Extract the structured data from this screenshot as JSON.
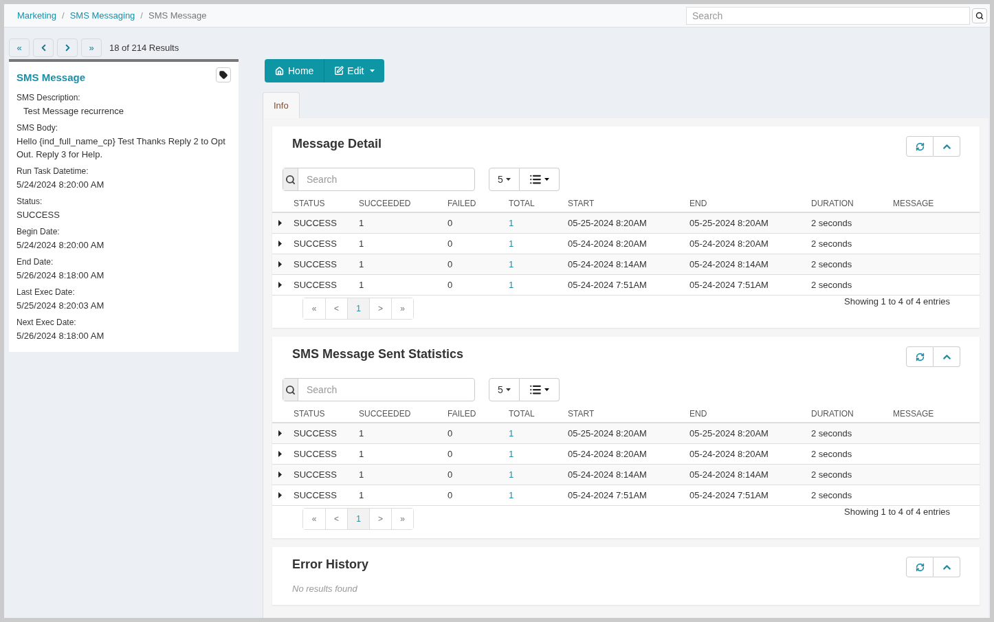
{
  "breadcrumb_separator": "/",
  "breadcrumb": [
    {
      "label": "Marketing",
      "current": false
    },
    {
      "label": "SMS Messaging",
      "current": false
    },
    {
      "label": "SMS Message",
      "current": true
    }
  ],
  "search": {
    "placeholder": "Search"
  },
  "record_nav": {
    "buttons": [
      {
        "kind": "first",
        "label": "«"
      },
      {
        "kind": "prev"
      },
      {
        "kind": "next"
      },
      {
        "kind": "last",
        "label": "»"
      }
    ],
    "results": "18 of 214 Results"
  },
  "sidebar": {
    "title": "SMS Message",
    "fields": [
      {
        "label": "SMS Description:",
        "value": "Test Message recurrence",
        "indented": true
      },
      {
        "label": "SMS Body:",
        "value": "Hello {ind_full_name_cp} Test Thanks Reply 2 to Opt Out. Reply 3 for Help.",
        "indented": false
      },
      {
        "label": "Run Task Datetime:",
        "value": "5/24/2024 8:20:00 AM",
        "indented": false
      },
      {
        "label": "Status:",
        "value": "SUCCESS",
        "indented": false
      },
      {
        "label": "Begin Date:",
        "value": "5/24/2024 8:20:00 AM",
        "indented": false
      },
      {
        "label": "End Date:",
        "value": "5/26/2024 8:18:00 AM",
        "indented": false
      },
      {
        "label": "Last Exec Date:",
        "value": "5/25/2024 8:20:03 AM",
        "indented": false
      },
      {
        "label": "Next Exec Date:",
        "value": "5/26/2024 8:18:00 AM",
        "indented": false
      }
    ]
  },
  "toolbar": {
    "home": "Home",
    "edit": "Edit"
  },
  "tabs": [
    {
      "label": "Info",
      "selected": true
    }
  ],
  "panels": [
    {
      "kind": "table",
      "title": "Message Detail",
      "search_placeholder": "Search",
      "page_size": "5",
      "columns": [
        "STATUS",
        "SUCCEEDED",
        "FAILED",
        "TOTAL",
        "START",
        "END",
        "DURATION",
        "MESSAGE"
      ],
      "rows": [
        {
          "status": "SUCCESS",
          "succeeded": "1",
          "failed": "0",
          "total": "1",
          "start": "05-25-2024 8:20AM",
          "end": "05-25-2024 8:20AM",
          "duration": "2 seconds"
        },
        {
          "status": "SUCCESS",
          "succeeded": "1",
          "failed": "0",
          "total": "1",
          "start": "05-24-2024 8:20AM",
          "end": "05-24-2024 8:20AM",
          "duration": "2 seconds"
        },
        {
          "status": "SUCCESS",
          "succeeded": "1",
          "failed": "0",
          "total": "1",
          "start": "05-24-2024 8:14AM",
          "end": "05-24-2024 8:14AM",
          "duration": "2 seconds"
        },
        {
          "status": "SUCCESS",
          "succeeded": "1",
          "failed": "0",
          "total": "1",
          "start": "05-24-2024 7:51AM",
          "end": "05-24-2024 7:51AM",
          "duration": "2 seconds"
        }
      ],
      "pagination": [
        {
          "label": "«",
          "selected": false
        },
        {
          "label": "<",
          "selected": false
        },
        {
          "label": "1",
          "selected": true
        },
        {
          "label": ">",
          "selected": false
        },
        {
          "label": "»",
          "selected": false
        }
      ],
      "info": "Showing 1 to 4 of 4 entries"
    },
    {
      "kind": "table",
      "title": "SMS Message Sent Statistics",
      "search_placeholder": "Search",
      "page_size": "5",
      "columns": [
        "STATUS",
        "SUCCEEDED",
        "FAILED",
        "TOTAL",
        "START",
        "END",
        "DURATION",
        "MESSAGE"
      ],
      "rows": [
        {
          "status": "SUCCESS",
          "succeeded": "1",
          "failed": "0",
          "total": "1",
          "start": "05-25-2024 8:20AM",
          "end": "05-25-2024 8:20AM",
          "duration": "2 seconds"
        },
        {
          "status": "SUCCESS",
          "succeeded": "1",
          "failed": "0",
          "total": "1",
          "start": "05-24-2024 8:20AM",
          "end": "05-24-2024 8:20AM",
          "duration": "2 seconds"
        },
        {
          "status": "SUCCESS",
          "succeeded": "1",
          "failed": "0",
          "total": "1",
          "start": "05-24-2024 8:14AM",
          "end": "05-24-2024 8:14AM",
          "duration": "2 seconds"
        },
        {
          "status": "SUCCESS",
          "succeeded": "1",
          "failed": "0",
          "total": "1",
          "start": "05-24-2024 7:51AM",
          "end": "05-24-2024 7:51AM",
          "duration": "2 seconds"
        }
      ],
      "pagination": [
        {
          "label": "«",
          "selected": false
        },
        {
          "label": "<",
          "selected": false
        },
        {
          "label": "1",
          "selected": true
        },
        {
          "label": ">",
          "selected": false
        },
        {
          "label": "»",
          "selected": false
        }
      ],
      "info": "Showing 1 to 4 of 4 entries"
    },
    {
      "kind": "empty",
      "title": "Error History",
      "empty_text": "No results found"
    }
  ]
}
